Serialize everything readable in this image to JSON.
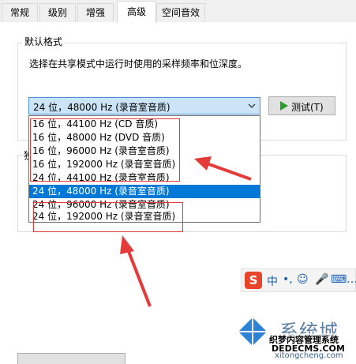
{
  "tabs": [
    {
      "label": "常规"
    },
    {
      "label": "级别"
    },
    {
      "label": "增强"
    },
    {
      "label": "高级"
    },
    {
      "label": "空间音效"
    }
  ],
  "default_format": {
    "title": "默认格式",
    "description": "选择在共享模式中运行时使用的采样频率和位深度。",
    "selected": "24 位，48000 Hz (录音室音质)",
    "test_button": "测试(T)"
  },
  "options": [
    "16 位，44100 Hz (CD 音质)",
    "16 位，48000 Hz (DVD 音质)",
    "16 位，96000 Hz (录音室音质)",
    "16 位，192000 Hz (录音室音质)",
    "24 位，44100 Hz (录音室音质)",
    "24 位，48000 Hz (录音室音质)",
    "24 位，96000 Hz (录音室音质)",
    "24 位，192000 Hz (录音室音质)"
  ],
  "lower_group_label": "独",
  "ime_bar": {
    "logo": "S",
    "mode": "中",
    "punct": "•,",
    "emoji": "☺",
    "mic": "🎤",
    "keyboard": "⌨",
    "more": "…"
  },
  "watermark": {
    "brand": "系统城",
    "sub1": "织梦内容管理系统",
    "sub2": "DEDECMS.COM",
    "url": "xitongcheng.com"
  },
  "colors": {
    "accent": "#0078d7",
    "combo_bg": "#cce4f7",
    "annotation_red": "#e53a3a"
  }
}
